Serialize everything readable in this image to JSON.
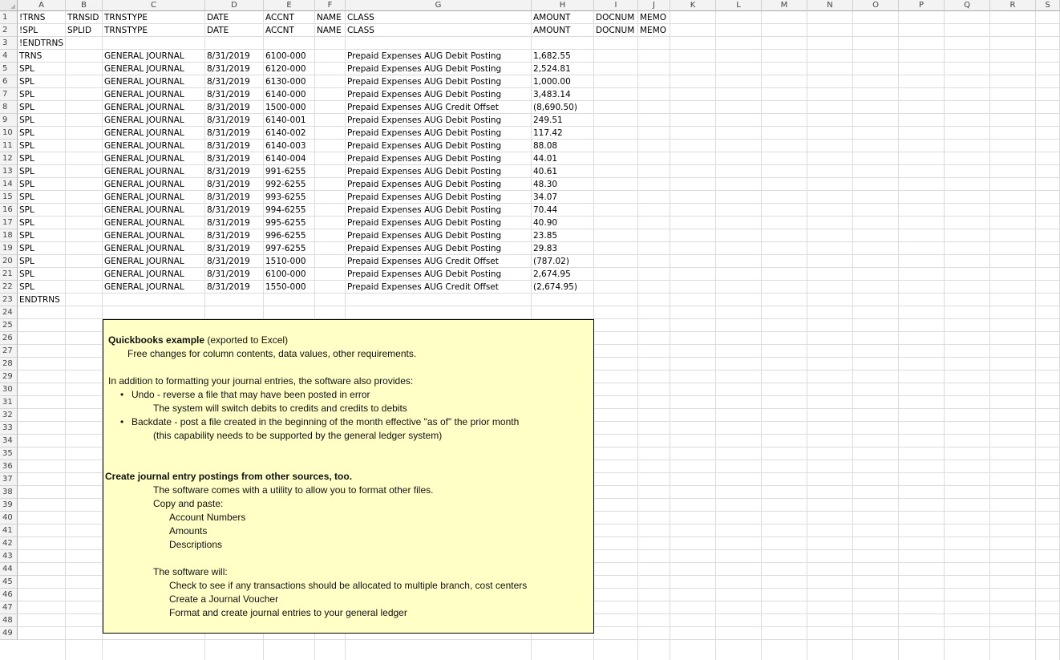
{
  "columns": [
    "A",
    "B",
    "C",
    "D",
    "E",
    "F",
    "G",
    "H",
    "I",
    "J",
    "K",
    "L",
    "M",
    "N",
    "O",
    "P",
    "Q",
    "R",
    "S"
  ],
  "row_numbers": [
    "1",
    "2",
    "3",
    "4",
    "5",
    "6",
    "7",
    "8",
    "9",
    "10",
    "11",
    "12",
    "13",
    "14",
    "15",
    "16",
    "17",
    "18",
    "19",
    "20",
    "21",
    "22",
    "23",
    "24",
    "25",
    "26",
    "27",
    "28",
    "29",
    "30",
    "31",
    "32",
    "33",
    "34",
    "35",
    "36",
    "37",
    "38",
    "39",
    "40",
    "41",
    "42",
    "43",
    "44",
    "45",
    "46",
    "47",
    "48",
    "49"
  ],
  "rows": [
    {
      "A": "!TRNS",
      "B": "TRNSID",
      "C": "TRNSTYPE",
      "D": "DATE",
      "E": "ACCNT",
      "F": "NAME",
      "G": "CLASS",
      "H": "AMOUNT",
      "I": "DOCNUM",
      "J": "MEMO"
    },
    {
      "A": "!SPL",
      "B": "SPLID",
      "C": "TRNSTYPE",
      "D": "DATE",
      "E": "ACCNT",
      "F": "NAME",
      "G": "CLASS",
      "H": "AMOUNT",
      "I": "DOCNUM",
      "J": "MEMO"
    },
    {
      "A": "!ENDTRNS"
    },
    {
      "A": "TRNS",
      "C": "GENERAL JOURNAL",
      "D": "8/31/2019",
      "E": "6100-000",
      "G": "Prepaid Expenses AUG Debit Posting",
      "H": "1,682.55"
    },
    {
      "A": "SPL",
      "C": "GENERAL JOURNAL",
      "D": "8/31/2019",
      "E": "6120-000",
      "G": "Prepaid Expenses AUG Debit Posting",
      "H": "2,524.81"
    },
    {
      "A": "SPL",
      "C": "GENERAL JOURNAL",
      "D": "8/31/2019",
      "E": "6130-000",
      "G": "Prepaid Expenses AUG Debit Posting",
      "H": "1,000.00"
    },
    {
      "A": "SPL",
      "C": "GENERAL JOURNAL",
      "D": "8/31/2019",
      "E": "6140-000",
      "G": "Prepaid Expenses AUG Debit Posting",
      "H": "3,483.14"
    },
    {
      "A": "SPL",
      "C": "GENERAL JOURNAL",
      "D": "8/31/2019",
      "E": "1500-000",
      "G": "Prepaid Expenses AUG Credit Offset",
      "H": "(8,690.50)"
    },
    {
      "A": "SPL",
      "C": "GENERAL JOURNAL",
      "D": "8/31/2019",
      "E": "6140-001",
      "G": "Prepaid Expenses AUG Debit Posting",
      "H": "249.51"
    },
    {
      "A": "SPL",
      "C": "GENERAL JOURNAL",
      "D": "8/31/2019",
      "E": "6140-002",
      "G": "Prepaid Expenses AUG Debit Posting",
      "H": "117.42"
    },
    {
      "A": "SPL",
      "C": "GENERAL JOURNAL",
      "D": "8/31/2019",
      "E": "6140-003",
      "G": "Prepaid Expenses AUG Debit Posting",
      "H": "88.08"
    },
    {
      "A": "SPL",
      "C": "GENERAL JOURNAL",
      "D": "8/31/2019",
      "E": "6140-004",
      "G": "Prepaid Expenses AUG Debit Posting",
      "H": "44.01"
    },
    {
      "A": "SPL",
      "C": "GENERAL JOURNAL",
      "D": "8/31/2019",
      "E": "991-6255",
      "G": "Prepaid Expenses AUG Debit Posting",
      "H": "40.61"
    },
    {
      "A": "SPL",
      "C": "GENERAL JOURNAL",
      "D": "8/31/2019",
      "E": "992-6255",
      "G": "Prepaid Expenses AUG Debit Posting",
      "H": "48.30"
    },
    {
      "A": "SPL",
      "C": "GENERAL JOURNAL",
      "D": "8/31/2019",
      "E": "993-6255",
      "G": "Prepaid Expenses AUG Debit Posting",
      "H": "34.07"
    },
    {
      "A": "SPL",
      "C": "GENERAL JOURNAL",
      "D": "8/31/2019",
      "E": "994-6255",
      "G": "Prepaid Expenses AUG Debit Posting",
      "H": "70.44"
    },
    {
      "A": "SPL",
      "C": "GENERAL JOURNAL",
      "D": "8/31/2019",
      "E": "995-6255",
      "G": "Prepaid Expenses AUG Debit Posting",
      "H": "40.90"
    },
    {
      "A": "SPL",
      "C": "GENERAL JOURNAL",
      "D": "8/31/2019",
      "E": "996-6255",
      "G": "Prepaid Expenses AUG Debit Posting",
      "H": "23.85"
    },
    {
      "A": "SPL",
      "C": "GENERAL JOURNAL",
      "D": "8/31/2019",
      "E": "997-6255",
      "G": "Prepaid Expenses AUG Debit Posting",
      "H": "29.83"
    },
    {
      "A": "SPL",
      "C": "GENERAL JOURNAL",
      "D": "8/31/2019",
      "E": "1510-000",
      "G": "Prepaid Expenses AUG Credit Offset",
      "H": "(787.02)"
    },
    {
      "A": "SPL",
      "C": "GENERAL JOURNAL",
      "D": "8/31/2019",
      "E": "6100-000",
      "G": "Prepaid Expenses AUG Debit Posting",
      "H": "2,674.95"
    },
    {
      "A": "SPL",
      "C": "GENERAL JOURNAL",
      "D": "8/31/2019",
      "E": "1550-000",
      "G": "Prepaid Expenses AUG Credit Offset",
      "H": "(2,674.95)"
    },
    {
      "A": "ENDTRNS"
    }
  ],
  "note": {
    "title": "Quickbooks example",
    "title_suffix": " (exported to Excel)",
    "line_free": "Free changes for column contents, data values, other requirements.",
    "line_addition": "In addition to formatting your journal entries, the software also provides:",
    "bullet_char": "•",
    "bullet_undo": "Undo - reverse a file that may have been posted in error",
    "undo_detail": "The system will switch debits to credits and credits to debits",
    "bullet_backdate": "Backdate - post a file created in the beginning of the month effective \"as of\" the prior month",
    "backdate_detail": "(this capability needs to be supported by the general ledger system)",
    "create_heading": "Create journal entry postings from other sources, too.",
    "utility_line": "The software comes with a utility to allow you to format other files.",
    "copy_paste": "Copy and paste:",
    "item_accounts": "Account Numbers",
    "item_amounts": "Amounts",
    "item_descriptions": "Descriptions",
    "software_will": "The software will:",
    "will_check": "Check to see if any transactions should be allocated to multiple branch, cost centers",
    "will_voucher": "Create a Journal Voucher",
    "will_format": "Format and create journal entries to your general ledger"
  }
}
